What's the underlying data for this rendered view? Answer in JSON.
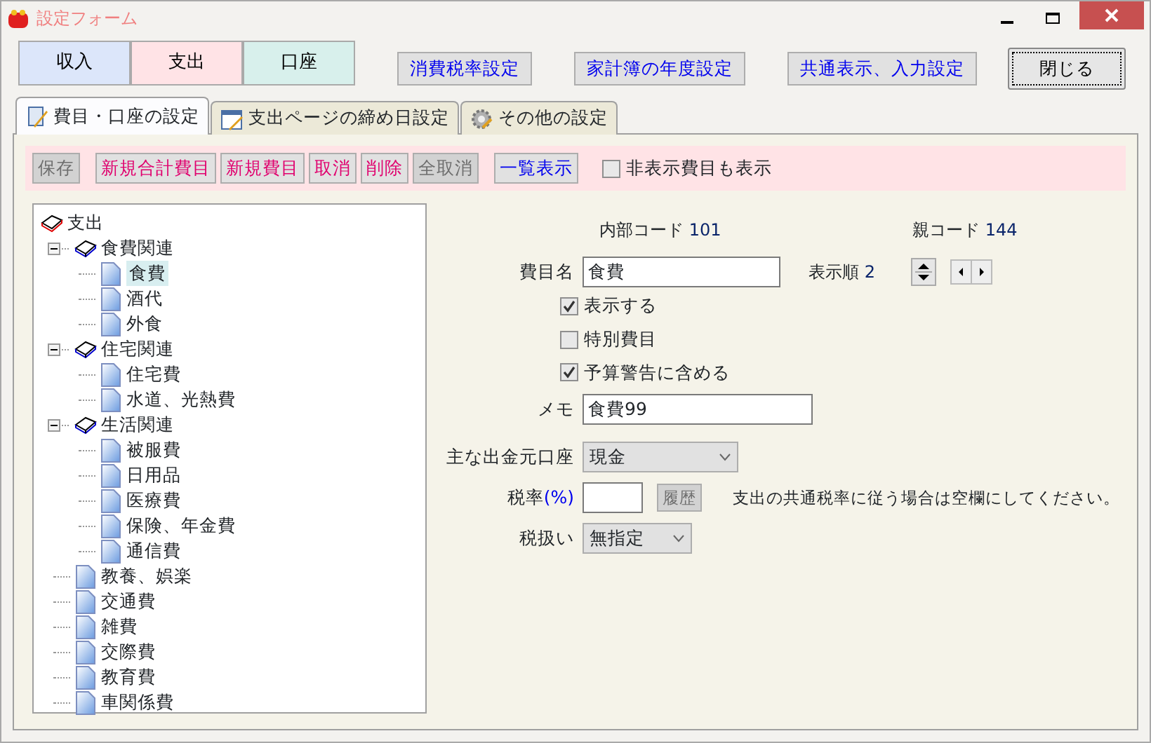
{
  "window": {
    "title": "設定フォーム"
  },
  "category_buttons": [
    {
      "label": "収入",
      "color": "#dce6fa"
    },
    {
      "label": "支出",
      "color": "#ffe3e6"
    },
    {
      "label": "口座",
      "color": "#d8f0ec"
    }
  ],
  "top_buttons": [
    {
      "label": "消費税率設定",
      "kind": "setting"
    },
    {
      "label": "家計簿の年度設定",
      "kind": "setting"
    },
    {
      "label": "共通表示、入力設定",
      "kind": "setting"
    },
    {
      "label": "閉じる",
      "kind": "close"
    }
  ],
  "tabs": [
    {
      "label": "費目・口座の設定",
      "kind": "book",
      "selected": true
    },
    {
      "label": "支出ページの締め日設定",
      "kind": "calendar",
      "selected": false
    },
    {
      "label": "その他の設定",
      "kind": "gear",
      "selected": false
    }
  ],
  "toolbar": {
    "buttons": [
      {
        "label": "保存",
        "kind": "action",
        "disabled": true
      },
      {
        "label": "新規合計費目",
        "kind": "action",
        "disabled": false
      },
      {
        "label": "新規費目",
        "kind": "action",
        "disabled": false
      },
      {
        "label": "取消",
        "kind": "action",
        "disabled": false
      },
      {
        "label": "削除",
        "kind": "action",
        "disabled": false
      },
      {
        "label": "全取消",
        "kind": "action",
        "disabled": true
      },
      {
        "label": "一覧表示",
        "kind": "view",
        "disabled": false
      }
    ],
    "checkbox": {
      "label": "非表示費目も表示",
      "checked": false
    }
  },
  "tree": {
    "label": "支出",
    "children": [
      {
        "label": "食費関連",
        "expanded": true,
        "children": [
          {
            "label": "食費",
            "selected": true
          },
          {
            "label": "酒代",
            "selected": false
          },
          {
            "label": "外食",
            "selected": false
          }
        ]
      },
      {
        "label": "住宅関連",
        "expanded": true,
        "children": [
          {
            "label": "住宅費",
            "selected": false
          },
          {
            "label": "水道、光熱費",
            "selected": false
          }
        ]
      },
      {
        "label": "生活関連",
        "expanded": true,
        "children": [
          {
            "label": "被服費",
            "selected": false
          },
          {
            "label": "日用品",
            "selected": false
          },
          {
            "label": "医療費",
            "selected": false
          },
          {
            "label": "保険、年金費",
            "selected": false
          },
          {
            "label": "通信費",
            "selected": false
          }
        ]
      },
      {
        "label": "教養、娯楽",
        "selected": false
      },
      {
        "label": "交通費",
        "selected": false
      },
      {
        "label": "雑費",
        "selected": false
      },
      {
        "label": "交際費",
        "selected": false
      },
      {
        "label": "教育費",
        "selected": false
      },
      {
        "label": "車関係費",
        "selected": false
      }
    ]
  },
  "form": {
    "internal_code": {
      "label": "内部コード",
      "value": "101"
    },
    "parent_code": {
      "label": "親コード",
      "value": "144"
    },
    "name": {
      "label": "費目名",
      "value": "食費"
    },
    "order": {
      "label": "表示順",
      "value": "2"
    },
    "checkboxes": [
      {
        "label": "表示する",
        "checked": true
      },
      {
        "label": "特別費目",
        "checked": false
      },
      {
        "label": "予算警告に含める",
        "checked": true
      }
    ],
    "memo": {
      "label": "メモ",
      "value": "食費99"
    },
    "account": {
      "label": "主な出金元口座",
      "value": "現金"
    },
    "tax_rate": {
      "label": "税率",
      "unit": "(%)"
    },
    "history_button": {
      "label": "履歴",
      "disabled": true
    },
    "tax_hint": "支出の共通税率に従う場合は空欄にしてください。",
    "tax_handling": {
      "label": "税扱い",
      "value": "無指定"
    }
  }
}
